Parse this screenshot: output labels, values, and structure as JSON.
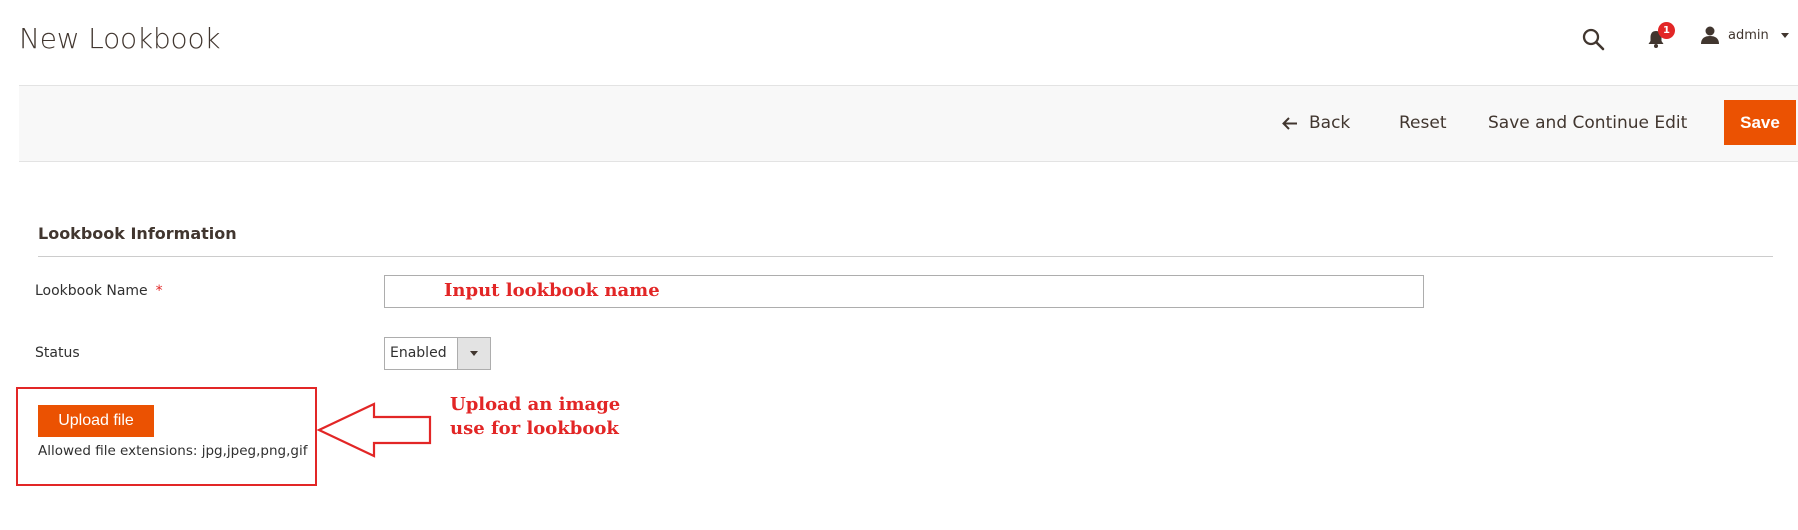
{
  "page": {
    "title": "New Lookbook"
  },
  "header": {
    "search_icon": "search-icon",
    "notifications": {
      "icon": "bell-icon",
      "count": "1"
    },
    "user": {
      "icon": "user-icon",
      "name": "admin"
    }
  },
  "actions": {
    "back_label": "Back",
    "reset_label": "Reset",
    "save_continue_label": "Save and Continue Edit",
    "save_label": "Save"
  },
  "form": {
    "section_title": "Lookbook Information",
    "name_label": "Lookbook Name",
    "required_mark": "*",
    "name_value": "",
    "status_label": "Status",
    "status_value": "Enabled",
    "upload_button": "Upload file",
    "allowed_extensions": "Allowed file extensions: jpg,jpeg,png,gif"
  },
  "annotations": {
    "name_hint": "Input lookbook name",
    "upload_hint_line1": "Upload an image",
    "upload_hint_line2": "use for lookbook"
  },
  "colors": {
    "accent": "#eb5202",
    "annotation": "#e22626",
    "bar_bg": "#f8f8f8"
  }
}
